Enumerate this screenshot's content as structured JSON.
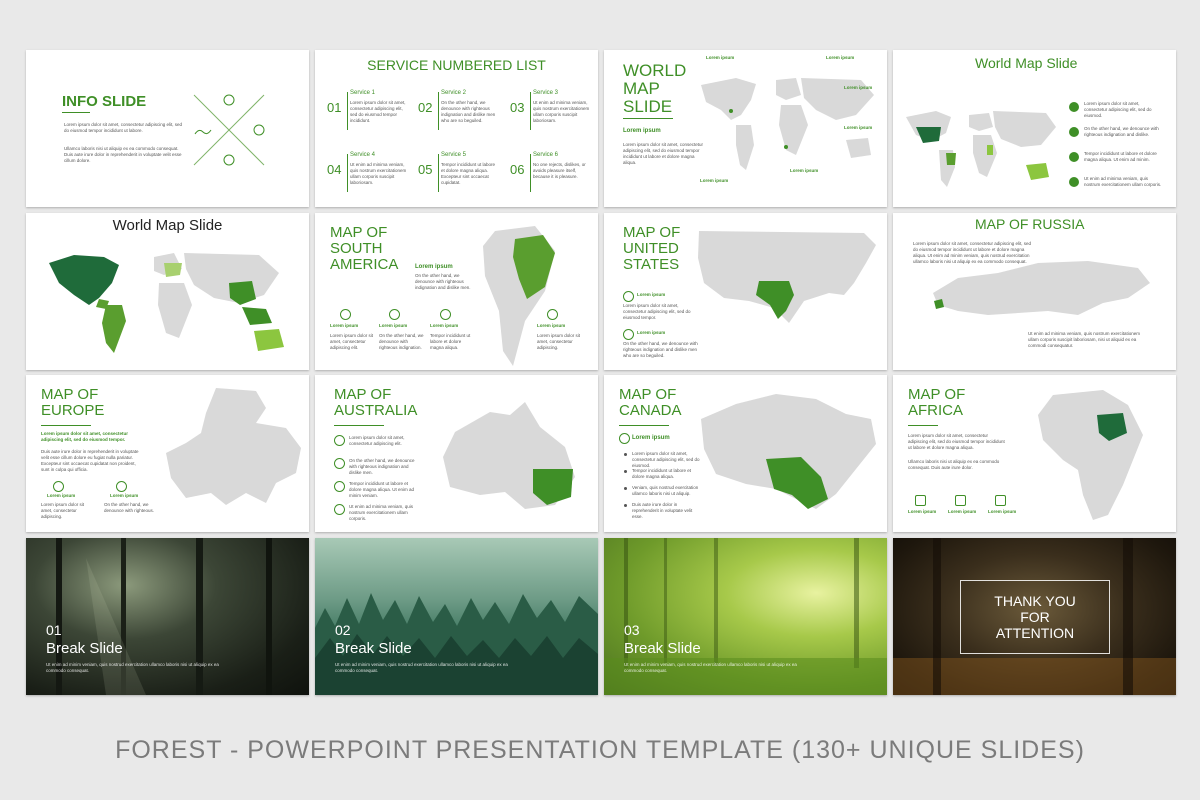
{
  "slides": {
    "info": {
      "title": "INFO SLIDE",
      "body1": "Lorem ipsum dolor sit amet, consectetur adipiscing elit, sed do eiusmod tempor incididunt ut labore.",
      "body2": "Ullamco laboris nisi ut aliquip ex ea commodo consequat. Duis aute irure dolor in reprehenderit in voluptate velit esse cillum dolore."
    },
    "service": {
      "title": "SERVICE NUMBERED LIST",
      "items": [
        {
          "num": "01",
          "label": "Service 1",
          "text": "Lorem ipsum dolor sit amet, consectetur adipiscing elit, sed do eiusmod tempor incididunt."
        },
        {
          "num": "02",
          "label": "Service 2",
          "text": "On the other hand, we denounce with righteous indignation and dislike men who are so beguiled."
        },
        {
          "num": "03",
          "label": "Service 3",
          "text": "Ut enim ad minima veniam, quis nostrum exercitationem ullam corporis suscipit laboriosam."
        },
        {
          "num": "04",
          "label": "Service 4",
          "text": "Ut enim ad minima veniam, quis nostrum exercitationem ullam corporis suscipit laboriosam."
        },
        {
          "num": "05",
          "label": "Service 5",
          "text": "Tempor incididunt ut labore et dolore magna aliqua. Excepteur sint occaecat cupidatat."
        },
        {
          "num": "06",
          "label": "Service 6",
          "text": "No one rejects, dislikes, or avoids pleasure itself, because it is pleasure."
        }
      ]
    },
    "world_map_1": {
      "title": "WORLD MAP SLIDE",
      "label": "Lorem ipsum",
      "body": "Lorem ipsum dolor sit amet, consectetur adipiscing elit, sed do eiusmod tempor incididunt ut labore et dolore magna aliqua.",
      "callouts": [
        "Lorem ipsum",
        "Lorem ipsum",
        "Lorem ipsum",
        "Lorem ipsum",
        "Lorem ipsum",
        "Lorem ipsum"
      ]
    },
    "world_map_2": {
      "title": "World Map Slide",
      "items": [
        "Lorem ipsum dolor sit amet, consectetur adipiscing elit, sed do eiusmod.",
        "On the other hand, we denounce with righteous indignation and dislike.",
        "Tempor incididunt ut labore et dolore magna aliqua. Ut enim ad minim.",
        "Ut enim ad minima veniam, quis nostrum exercitationem ullam corporis."
      ]
    },
    "world_map_3": {
      "title": "World Map Slide"
    },
    "south_america": {
      "title": "MAP OF SOUTH AMERICA",
      "callout_label": "Lorem ipsum",
      "callout_body": "On the other hand, we denounce with righteous indignation and dislike men.",
      "items": [
        {
          "label": "Lorem ipsum",
          "text": "Lorem ipsum dolor sit amet, consectetur adipiscing elit."
        },
        {
          "label": "Lorem ipsum",
          "text": "On the other hand, we denounce with righteous indignation."
        },
        {
          "label": "Lorem ipsum",
          "text": "Tempor incididunt ut labore et dolore magna aliqua."
        },
        {
          "label": "Lorem ipsum",
          "text": "Lorem ipsum dolor sit amet, consectetur adipiscing."
        }
      ]
    },
    "united_states": {
      "title": "MAP OF UNITED STATES",
      "items": [
        {
          "label": "Lorem ipsum",
          "text": "Lorem ipsum dolor sit amet, consectetur adipiscing elit, sed do eiusmod tempor."
        },
        {
          "label": "Lorem ipsum",
          "text": "On the other hand, we denounce with righteous indignation and dislike men who are so beguiled."
        }
      ]
    },
    "russia": {
      "title": "MAP OF RUSSIA",
      "body1": "Lorem ipsum dolor sit amet, consectetur adipiscing elit, sed do eiusmod tempor incididunt ut labore et dolore magna aliqua. Ut enim ad minim veniam, quis nostrud exercitation ullamco laboris nisi ut aliquip ex ea commodo consequat.",
      "body2": "Ut enim ad minima veniam, quis nostrum exercitationem ullam corporis suscipit laboriosam, nisi ut aliquid ex ea commodi consequatur."
    },
    "europe": {
      "title": "MAP OF EUROPE",
      "lead": "Lorem ipsum dolor sit amet, consectetur adipiscing elit, sed do eiusmod tempor.",
      "body": "Duis aute irure dolor in reprehenderit in voluptate velit esse cillum dolore eu fugiat nulla pariatur. Excepteur sint occaecat cupidatat non proident, sunt in culpa qui officia.",
      "items": [
        {
          "label": "Lorem ipsum",
          "text": "Lorem ipsum dolor sit amet, consectetur adipiscing."
        },
        {
          "label": "Lorem ipsum",
          "text": "On the other hand, we denounce with righteous."
        }
      ]
    },
    "australia": {
      "title": "MAP OF AUSTRALIA",
      "items": [
        "Lorem ipsum dolor sit amet, consectetur adipiscing elit.",
        "On the other hand, we denounce with righteous indignation and dislike men.",
        "Tempor incididunt ut labore et dolore magna aliqua. Ut enim ad minim veniam.",
        "Ut enim ad minima veniam, quis nostrum exercitationem ullam corporis."
      ]
    },
    "canada": {
      "title": "MAP OF CANADA",
      "label": "Lorem ipsum",
      "items": [
        "Lorem ipsum dolor sit amet, consectetur adipiscing elit, sed do eiusmod.",
        "Tempor incididunt ut labore et dolore magna aliqua.",
        "Veniam, quis nostrud exercitation ullamco laboris nisi ut aliquip.",
        "Duis aute irure dolor in reprehenderit in voluptate velit esse."
      ]
    },
    "africa": {
      "title": "MAP OF AFRICA",
      "body1": "Lorem ipsum dolor sit amet, consectetur adipiscing elit, sed do eiusmod tempor incididunt ut labore et dolore magna aliqua.",
      "body2": "Ullamco laboris nisi ut aliquip ex ea commodo consequat. Duis aute irure dolor.",
      "items": [
        "Lorem ipsum",
        "Lorem ipsum",
        "Lorem ipsum"
      ]
    },
    "break1": {
      "num": "01",
      "title": "Break Slide",
      "body": "Ut enim ad minim veniam, quis nostrud exercitation ullamco laboris nisi ut aliquip ex ea commodo consequat."
    },
    "break2": {
      "num": "02",
      "title": "Break Slide",
      "body": "Ut enim ad minim veniam, quis nostrud exercitation ullamco laboris nisi ut aliquip ex ea commodo consequat."
    },
    "break3": {
      "num": "03",
      "title": "Break Slide",
      "body": "Ut enim ad minim veniam, quis nostrud exercitation ullamco laboris nisi ut aliquip ex ea commodo consequat."
    },
    "thanks": {
      "line1": "THANK YOU",
      "line2": "FOR",
      "line3": "ATTENTION"
    }
  },
  "caption": "FOREST - POWERPOINT PRESENTATION TEMPLATE  (130+ UNIQUE SLIDES)",
  "colors": {
    "accent": "#3f8f27",
    "dark_green": "#1f6b3a",
    "light_green": "#8cc63f",
    "map_gray": "#d9d9d9",
    "background": "#e9e9e9"
  }
}
